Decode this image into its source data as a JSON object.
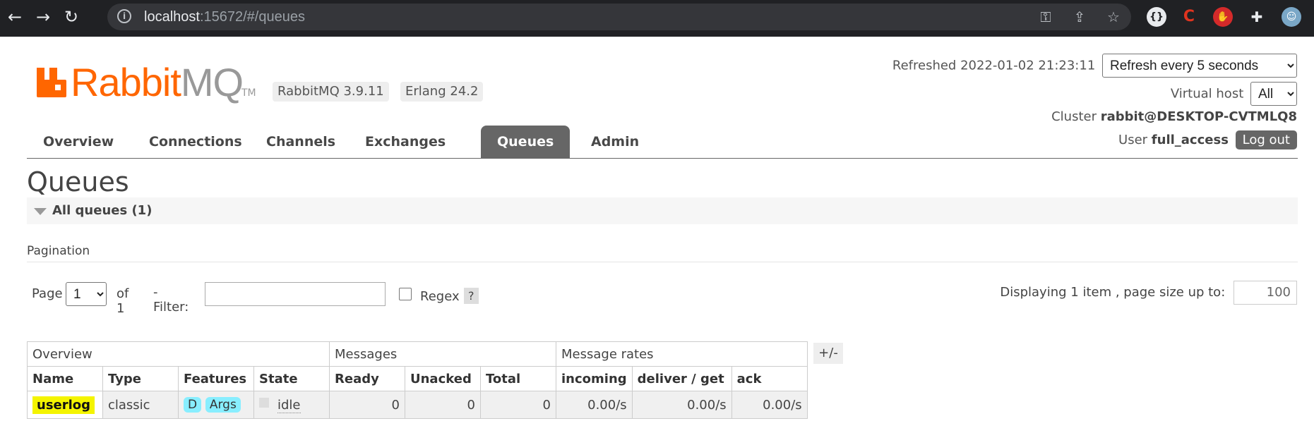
{
  "browser": {
    "url_host": "localhost",
    "url_rest": ":15672/#/queues"
  },
  "app": {
    "brand_rabbit": "Rabbit",
    "brand_mq": "MQ",
    "brand_tm": "TM",
    "version": "RabbitMQ 3.9.11",
    "erlang": "Erlang 24.2"
  },
  "header": {
    "refreshed_label": "Refreshed",
    "refreshed_time": "2022-01-02 21:23:11",
    "refresh_option": "Refresh every 5 seconds",
    "vhost_label": "Virtual host",
    "vhost_value": "All",
    "cluster_label": "Cluster",
    "cluster_value": "rabbit@DESKTOP-CVTMLQ8",
    "user_label": "User",
    "user_value": "full_access",
    "logout_label": "Log out"
  },
  "tabs": [
    "Overview",
    "Connections",
    "Channels",
    "Exchanges",
    "Queues",
    "Admin"
  ],
  "active_tab": "Queues",
  "page": {
    "title": "Queues",
    "section": "All queues (1)",
    "pagination_title": "Pagination",
    "page_label": "Page",
    "page_value": "1",
    "of_label": "of 1",
    "filter_label": "- Filter:",
    "regex_label": "Regex",
    "help_label": "?",
    "display_label": "Displaying 1 item , page size up to:",
    "page_size": "100"
  },
  "table": {
    "groups": [
      "Overview",
      "Messages",
      "Message rates"
    ],
    "headers": [
      "Name",
      "Type",
      "Features",
      "State",
      "Ready",
      "Unacked",
      "Total",
      "incoming",
      "deliver / get",
      "ack"
    ],
    "plus_minus": "+/-",
    "row": {
      "name": "userlog",
      "type": "classic",
      "feature_d": "D",
      "feature_args": "Args",
      "state": "idle",
      "ready": "0",
      "unacked": "0",
      "total": "0",
      "incoming": "0.00/s",
      "deliver_get": "0.00/s",
      "ack": "0.00/s"
    }
  }
}
